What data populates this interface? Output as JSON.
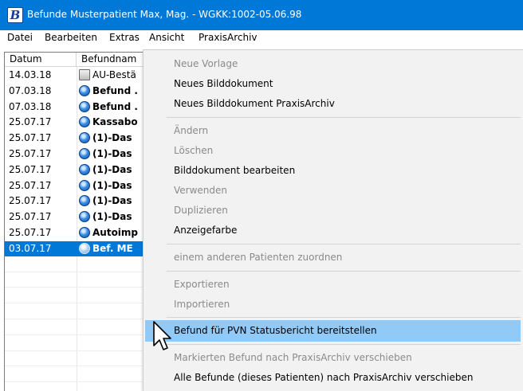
{
  "window": {
    "title": "Befunde Musterpatient Max, Mag. - WGKK:1002-05.06.98",
    "app_icon_letter": "B"
  },
  "menubar": [
    "Datei",
    "Bearbeiten",
    "Extras",
    "Ansicht",
    "PraxisArchiv"
  ],
  "list": {
    "headers": {
      "date": "Datum",
      "name": "Befundnam"
    },
    "rows": [
      {
        "date": "14.03.18",
        "name": "AU-Bestä",
        "bold": false,
        "icon": "document-icon"
      },
      {
        "date": "07.03.18",
        "name": "Befund .",
        "bold": true,
        "icon": "befund-icon"
      },
      {
        "date": "07.03.18",
        "name": "Befund .",
        "bold": true,
        "icon": "befund-icon"
      },
      {
        "date": "25.07.17",
        "name": "Kassabo",
        "bold": true,
        "icon": "befund-icon"
      },
      {
        "date": "25.07.17",
        "name": "(1)-Das",
        "bold": true,
        "icon": "befund-icon"
      },
      {
        "date": "25.07.17",
        "name": "(1)-Das",
        "bold": true,
        "icon": "befund-icon"
      },
      {
        "date": "25.07.17",
        "name": "(1)-Das",
        "bold": true,
        "icon": "befund-icon"
      },
      {
        "date": "25.07.17",
        "name": "(1)-Das",
        "bold": true,
        "icon": "befund-icon"
      },
      {
        "date": "25.07.17",
        "name": "(1)-Das",
        "bold": true,
        "icon": "befund-icon"
      },
      {
        "date": "25.07.17",
        "name": "(1)-Das",
        "bold": true,
        "icon": "befund-icon"
      },
      {
        "date": "25.07.17",
        "name": "Autoimp",
        "bold": true,
        "icon": "befund-icon"
      },
      {
        "date": "03.07.17",
        "name": "Bef. ME",
        "bold": true,
        "icon": "befund-icon",
        "selected": true
      }
    ]
  },
  "context_menu": {
    "items": [
      {
        "label": "Neue Vorlage",
        "enabled": false
      },
      {
        "label": "Neues Bilddokument",
        "enabled": true
      },
      {
        "label": "Neues Bilddokument PraxisArchiv",
        "enabled": true
      },
      {
        "label": "Ändern",
        "enabled": false
      },
      {
        "label": "Löschen",
        "enabled": false
      },
      {
        "label": "Bilddokument bearbeiten",
        "enabled": true
      },
      {
        "label": "Verwenden",
        "enabled": false
      },
      {
        "label": "Duplizieren",
        "enabled": false
      },
      {
        "label": "Anzeigefarbe",
        "enabled": true
      },
      {
        "label": "einem anderen Patienten zuordnen",
        "enabled": false
      },
      {
        "label": "Exportieren",
        "enabled": false
      },
      {
        "label": "Importieren",
        "enabled": false
      },
      {
        "label": "Befund für PVN Statusbericht bereitstellen",
        "enabled": true,
        "highlighted": true
      },
      {
        "label": "Markierten Befund nach PraxisArchiv verschieben",
        "enabled": false
      },
      {
        "label": "Alle Befunde (dieses Patienten) nach PraxisArchiv verschieben",
        "enabled": true
      }
    ]
  },
  "colors": {
    "titlebar": "#0078d7",
    "selection": "#0078d7",
    "menu_highlight": "#91c9f7",
    "menu_bg": "#f2f2f2",
    "disabled_text": "#8a8a8a"
  }
}
